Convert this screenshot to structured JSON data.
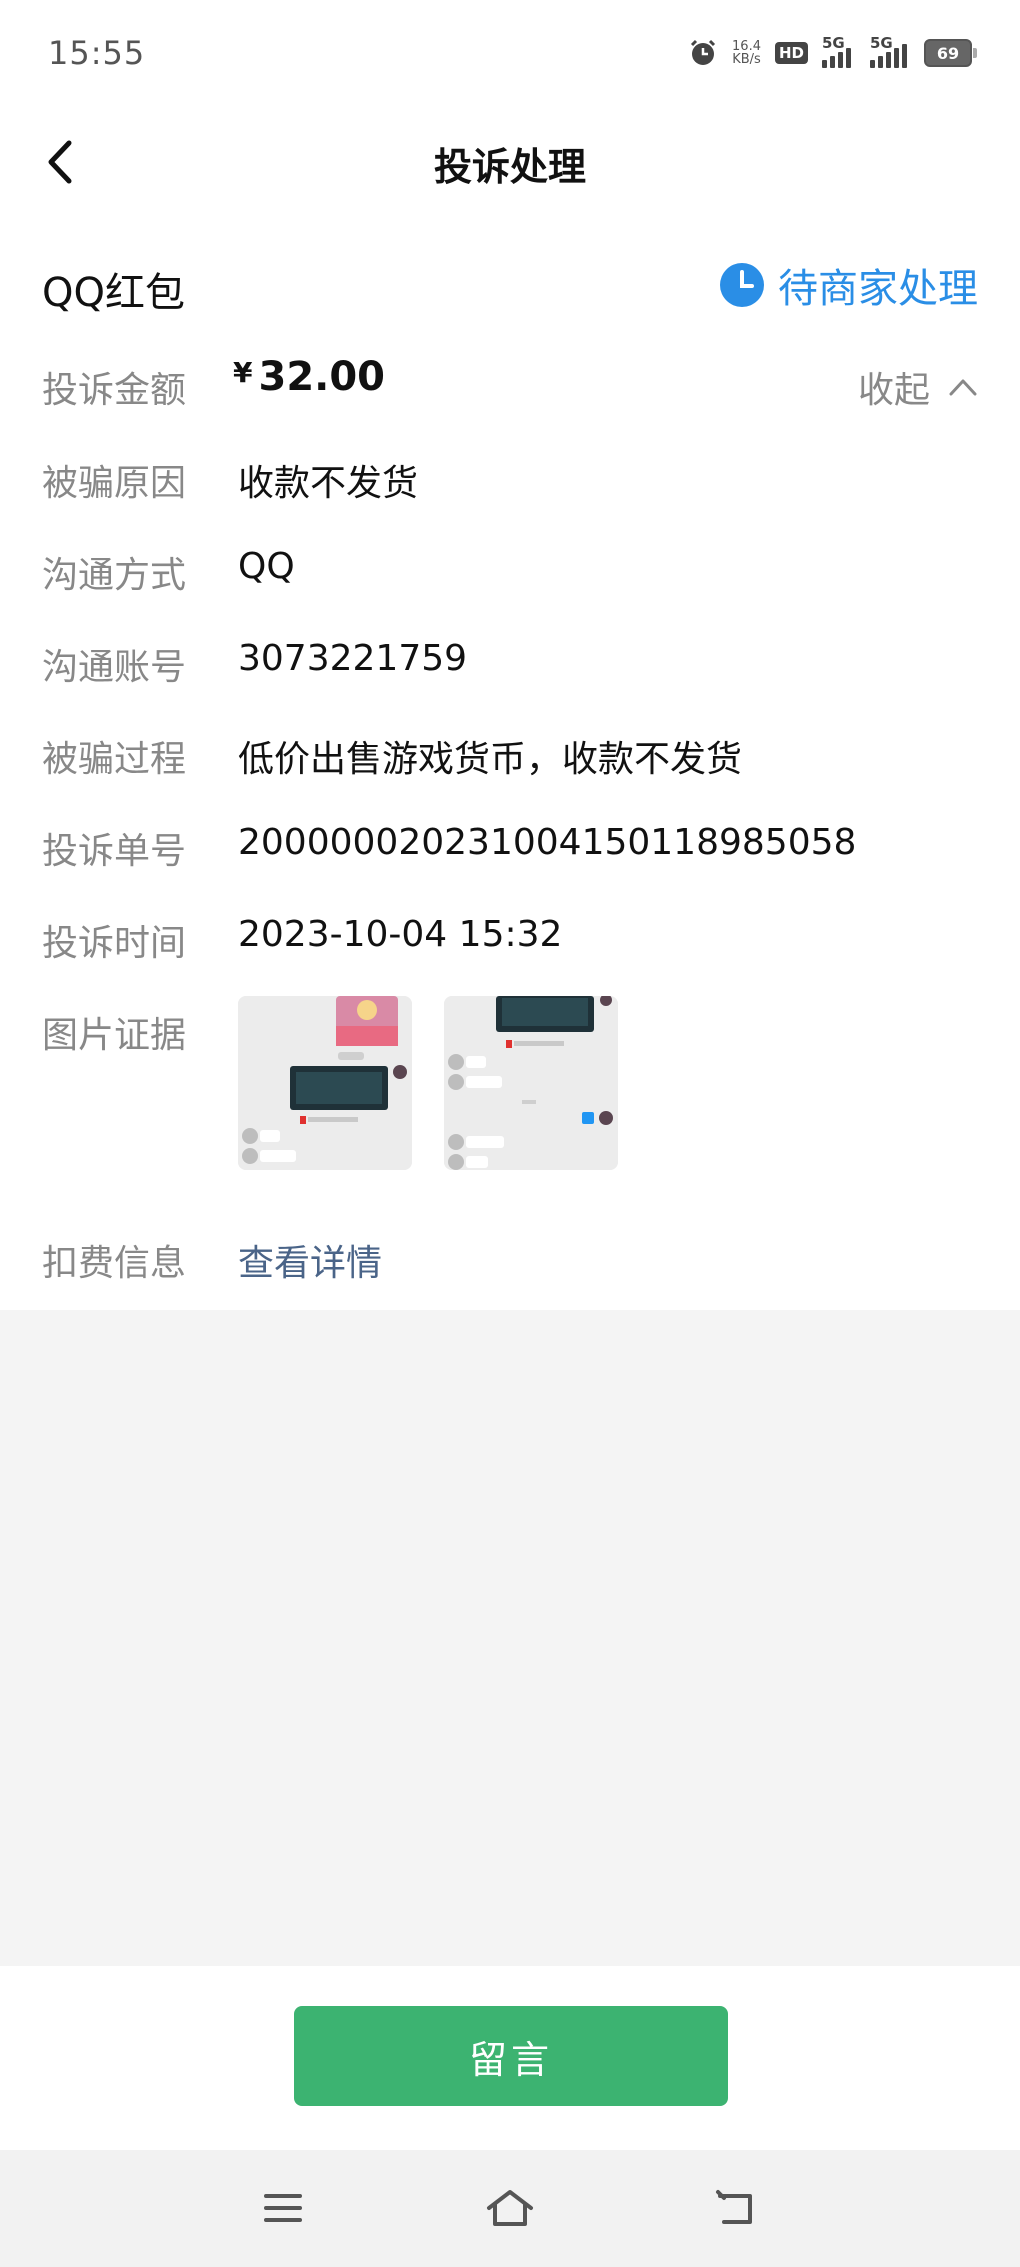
{
  "status_bar": {
    "time": "15:55",
    "net_speed_value": "16.4",
    "net_speed_unit": "KB/s",
    "hd_label": "HD",
    "signal1_label": "5G",
    "signal2_label": "5G",
    "battery_level": "69"
  },
  "header": {
    "title": "投诉处理"
  },
  "complaint": {
    "merchant": "QQ红包",
    "status": "待商家处理",
    "status_color": "#2a8ee6",
    "amount_label": "投诉金额",
    "currency_symbol": "¥",
    "amount": "32.00",
    "collapse_label": "收起",
    "reason_label": "被骗原因",
    "reason_value": "收款不发货",
    "contact_method_label": "沟通方式",
    "contact_method_value": "QQ",
    "contact_account_label": "沟通账号",
    "contact_account_value": "3073221759",
    "process_label": "被骗过程",
    "process_value": "低价出售游戏货币，收款不发货",
    "order_no_label": "投诉单号",
    "order_no_value": "200000020231004150118985058",
    "time_label": "投诉时间",
    "time_value": "2023-10-04 15:32",
    "evidence_label": "图片证据",
    "fee_label": "扣费信息",
    "fee_link": "查看详情",
    "link_color": "#4a6488"
  },
  "actions": {
    "message_button": "留言",
    "button_color": "#3cb371"
  },
  "system_nav": {
    "menu_icon": "menu-icon",
    "home_icon": "home-icon",
    "back_icon": "back-icon"
  }
}
